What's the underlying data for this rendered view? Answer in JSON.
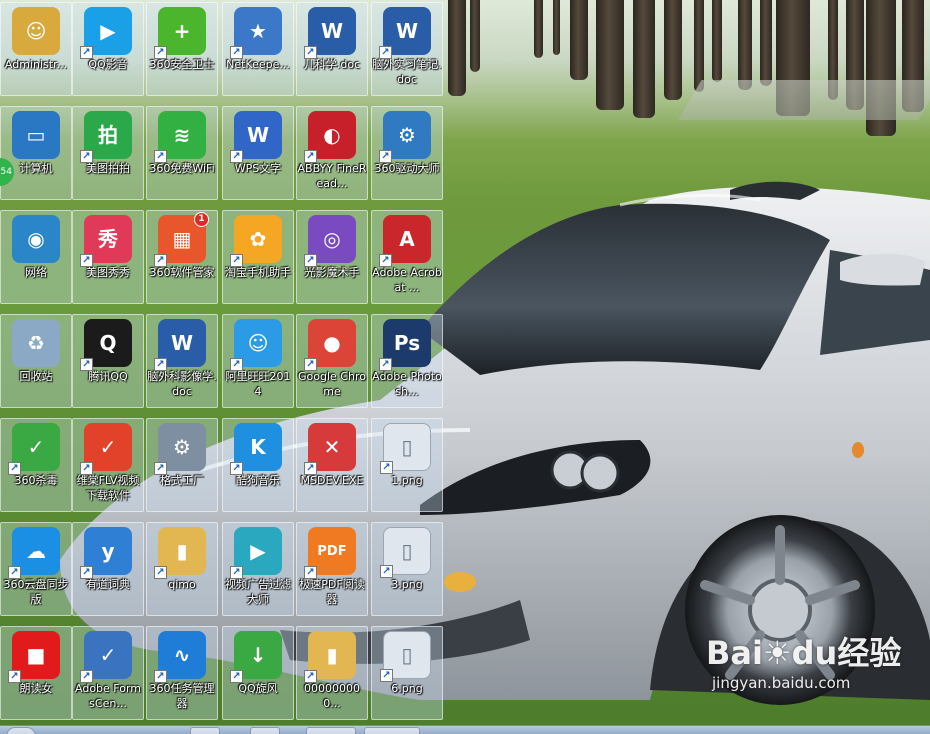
{
  "desktop": {
    "icons": [
      {
        "label": "Administr...",
        "icon": "user-folder-icon",
        "color": "#d8a93c"
      },
      {
        "label": "QQ影音",
        "icon": "qq-player-icon",
        "color": "#1aa0e6"
      },
      {
        "label": "360安全卫士",
        "icon": "360-security-icon",
        "color": "#4bb52e"
      },
      {
        "label": "NetKeepe...",
        "icon": "netkeeper-icon",
        "color": "#3b79c8"
      },
      {
        "label": "儿科学.doc",
        "icon": "word-doc-icon",
        "color": "#2a5da8"
      },
      {
        "label": "脑外实习笔记.doc",
        "icon": "word-doc-icon",
        "color": "#2a5da8"
      },
      {
        "label": "计算机",
        "icon": "computer-icon",
        "color": "#2a77c4"
      },
      {
        "label": "美图拍拍",
        "icon": "meitu-paipai-icon",
        "color": "#2aa84a"
      },
      {
        "label": "360免费WiFi",
        "icon": "wifi-icon",
        "color": "#32b041"
      },
      {
        "label": "WPS文字",
        "icon": "wps-writer-icon",
        "color": "#2f66c7"
      },
      {
        "label": "ABBYY FineRead...",
        "icon": "abbyy-icon",
        "color": "#c8202a"
      },
      {
        "label": "360驱动大师",
        "icon": "driver-master-icon",
        "color": "#2f7ac0"
      },
      {
        "label": "网络",
        "icon": "network-icon",
        "color": "#2a86c9"
      },
      {
        "label": "美图秀秀",
        "icon": "meitu-xiuxiu-icon",
        "color": "#e03a58"
      },
      {
        "label": "360软件管家",
        "icon": "software-manager-icon",
        "color": "#e8572c",
        "badge": "1"
      },
      {
        "label": "淘宝手机助手",
        "icon": "taobao-assistant-icon",
        "color": "#f5a623"
      },
      {
        "label": "光影魔术手",
        "icon": "nevercolor-icon",
        "color": "#7a4bc0"
      },
      {
        "label": "Adobe Acrobat ...",
        "icon": "acrobat-icon",
        "color": "#c9272b"
      },
      {
        "label": "回收站",
        "icon": "recycle-bin-icon",
        "color": "#8ba9c4"
      },
      {
        "label": "腾讯QQ",
        "icon": "qq-penguin-icon",
        "color": "#1b1b1b"
      },
      {
        "label": "脑外科影像学.doc",
        "icon": "word-doc-icon",
        "color": "#2a5da8"
      },
      {
        "label": "阿里旺旺2014",
        "icon": "aliwangwang-icon",
        "color": "#2b9be8"
      },
      {
        "label": "Google Chrome",
        "icon": "chrome-icon",
        "color": "#db4437"
      },
      {
        "label": "Adobe Photosh...",
        "icon": "photoshop-icon",
        "color": "#1c3a6b"
      },
      {
        "label": "360杀毒",
        "icon": "antivirus-icon",
        "color": "#3aa843"
      },
      {
        "label": "维棠FLV视频下载软件",
        "icon": "flv-downloader-icon",
        "color": "#e3422a"
      },
      {
        "label": "格式工厂",
        "icon": "format-factory-icon",
        "color": "#7e8fa2"
      },
      {
        "label": "酷狗音乐",
        "icon": "kugou-icon",
        "color": "#1f8fe0"
      },
      {
        "label": "MSDEV.EXE",
        "icon": "msdev-icon",
        "color": "#d63a3a"
      },
      {
        "label": "1.png",
        "icon": "image-file-icon",
        "color": "#dfe6ee"
      },
      {
        "label": "360云盘同步版",
        "icon": "cloud-sync-icon",
        "color": "#1b8fe3"
      },
      {
        "label": "有道词典",
        "icon": "youdao-icon",
        "color": "#2f7fd4"
      },
      {
        "label": "qimo",
        "icon": "folder-icon",
        "color": "#e2b651"
      },
      {
        "label": "视频广告过滤大师",
        "icon": "ad-filter-icon",
        "color": "#2aa8c0"
      },
      {
        "label": "极速PDF阅读器",
        "icon": "pdf-reader-icon",
        "color": "#f07a22"
      },
      {
        "label": "3.png",
        "icon": "image-file-icon",
        "color": "#dfe6ee"
      },
      {
        "label": "朗读女",
        "icon": "reader-girl-icon",
        "color": "#e11b1b"
      },
      {
        "label": "Adobe FormsCen...",
        "icon": "forms-central-icon",
        "color": "#3a74c1"
      },
      {
        "label": "360任务管理器",
        "icon": "task-manager-icon",
        "color": "#1f7dd8"
      },
      {
        "label": "QQ旋风",
        "icon": "qq-whirlwind-icon",
        "color": "#3aa843"
      },
      {
        "label": "000000000...",
        "icon": "folder-icon",
        "color": "#e2b651"
      },
      {
        "label": "6.png",
        "icon": "image-file-icon",
        "color": "#dfe6ee"
      }
    ],
    "side_badge": "54"
  },
  "watermark": {
    "brand": "Bai%du经验",
    "url": "jingyan.baidu.com"
  }
}
